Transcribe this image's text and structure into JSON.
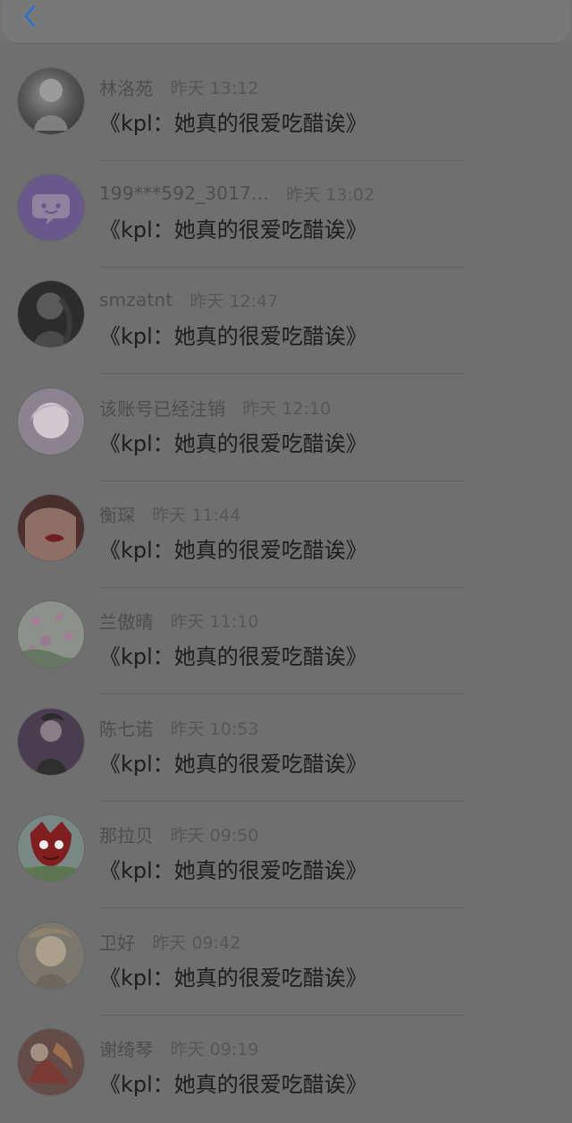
{
  "header": {
    "back_icon": "back-chevron-icon"
  },
  "colors": {
    "accent": "#1f74d9",
    "background": "#6f6f6f"
  },
  "list": [
    {
      "name": "林洛苑",
      "time": "昨天 13:12",
      "message": "《kpl：她真的很爱吃醋诶》",
      "avatar_icon": "avatar-image-icon"
    },
    {
      "name": "199***592_3017…",
      "time": "昨天 13:02",
      "message": "《kpl：她真的很爱吃醋诶》",
      "avatar_icon": "chat-bubble-avatar-icon"
    },
    {
      "name": "smzatnt",
      "time": "昨天 12:47",
      "message": "《kpl：她真的很爱吃醋诶》",
      "avatar_icon": "avatar-image-icon"
    },
    {
      "name": "该账号已经注销",
      "time": "昨天 12:10",
      "message": "《kpl：她真的很爱吃醋诶》",
      "avatar_icon": "avatar-image-icon"
    },
    {
      "name": "衡琛",
      "time": "昨天 11:44",
      "message": "《kpl：她真的很爱吃醋诶》",
      "avatar_icon": "avatar-image-icon"
    },
    {
      "name": "兰傲晴",
      "time": "昨天 11:10",
      "message": "《kpl：她真的很爱吃醋诶》",
      "avatar_icon": "avatar-image-icon"
    },
    {
      "name": "陈七诺",
      "time": "昨天 10:53",
      "message": "《kpl：她真的很爱吃醋诶》",
      "avatar_icon": "avatar-image-icon"
    },
    {
      "name": "那拉贝",
      "time": "昨天 09:50",
      "message": "《kpl：她真的很爱吃醋诶》",
      "avatar_icon": "avatar-image-icon"
    },
    {
      "name": "卫好",
      "time": "昨天 09:42",
      "message": "《kpl：她真的很爱吃醋诶》",
      "avatar_icon": "avatar-image-icon"
    },
    {
      "name": "谢绮琴",
      "time": "昨天 09:19",
      "message": "《kpl：她真的很爱吃醋诶》",
      "avatar_icon": "avatar-image-icon"
    }
  ]
}
